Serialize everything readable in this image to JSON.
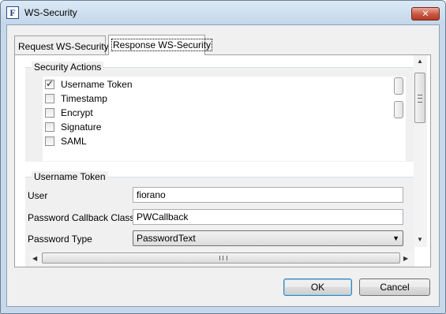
{
  "window": {
    "title": "WS-Security",
    "icon_letter": "F",
    "close_label": "✕"
  },
  "tabs": [
    {
      "label": "Request WS-Security",
      "selected": false
    },
    {
      "label": "Response WS-Security",
      "selected": true
    }
  ],
  "security_actions": {
    "title": "Security Actions",
    "items": [
      {
        "label": "Username Token",
        "checked": true,
        "mark": "✓"
      },
      {
        "label": "Timestamp",
        "checked": false,
        "mark": ""
      },
      {
        "label": "Encrypt",
        "checked": false,
        "mark": ""
      },
      {
        "label": "Signature",
        "checked": false,
        "mark": ""
      },
      {
        "label": "SAML",
        "checked": false,
        "mark": ""
      }
    ]
  },
  "username_token": {
    "title": "Username Token",
    "user_label": "User",
    "user_value": "fiorano",
    "callback_label": "Password Callback Class",
    "callback_value": "PWCallback",
    "password_type_label": "Password Type",
    "password_type_value": "PasswordText"
  },
  "scrollbars": {
    "up_arrow": "▲",
    "down_arrow": "▼",
    "left_arrow": "◀",
    "right_arrow": "▶",
    "dropdown_arrow": "▼"
  },
  "buttons": {
    "ok_label": "OK",
    "cancel_label": "Cancel"
  },
  "colors": {
    "frame": "#c6d8ea",
    "close_button": "#c8573f",
    "default_button_border": "#3c7fb1"
  }
}
